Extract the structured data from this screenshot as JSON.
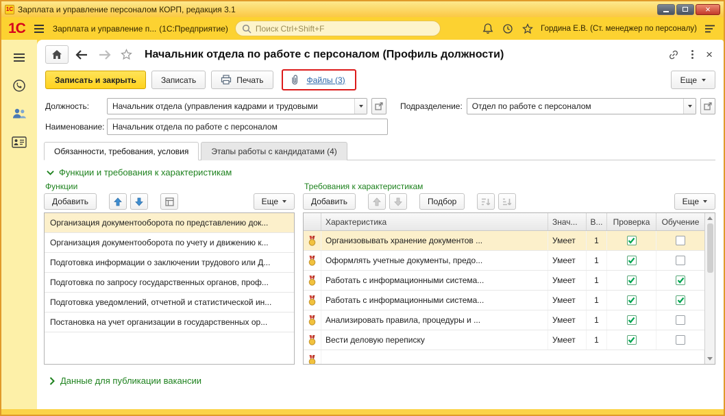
{
  "colors": {
    "accent_yellow": "#fcd231",
    "green": "#1e821e",
    "link_blue": "#2b66a8",
    "check_green": "#00a651",
    "annotation_red": "#dc1a1a"
  },
  "window": {
    "title": "Зарплата и управление персоналом КОРП, редакция 3.1"
  },
  "appbar": {
    "logo": "1С",
    "app_name": "Зарплата и управление п...",
    "app_kind": "(1С:Предприятие)",
    "search_placeholder": "Поиск Ctrl+Shift+F",
    "user": "Гордина Е.В. (Ст. менеджер по персоналу)"
  },
  "page": {
    "title": "Начальник отдела по работе с персоналом (Профиль должности)"
  },
  "toolbar": {
    "save_close": "Записать и закрыть",
    "save": "Записать",
    "print": "Печать",
    "files_link": "Файлы (3)",
    "more": "Еще"
  },
  "fields": {
    "position_label": "Должность:",
    "position_value": "Начальник отдела (управления кадрами и трудовыми",
    "department_label": "Подразделение:",
    "department_value": "Отдел по работе с персоналом",
    "name_label": "Наименование:",
    "name_value": "Начальник отдела по работе с персоналом"
  },
  "tabs": [
    {
      "label": "Обязанности, требования, условия",
      "active": true
    },
    {
      "label": "Этапы работы с кандидатами (4)",
      "active": false
    }
  ],
  "groups": {
    "functions_requirements": "Функции и требования к характеристикам",
    "vacancy": "Данные для публикации вакансии"
  },
  "functions": {
    "title": "Функции",
    "add": "Добавить",
    "more": "Еще",
    "items": [
      {
        "label": "Организация документооборота по представлению док...",
        "selected": true
      },
      {
        "label": "Организация документооборота по учету и движению к...",
        "selected": false
      },
      {
        "label": "Подготовка информации о заключении трудового или Д...",
        "selected": false
      },
      {
        "label": "Подготовка по запросу государственных органов, проф...",
        "selected": false
      },
      {
        "label": "Подготовка уведомлений, отчетной и статистической ин...",
        "selected": false
      },
      {
        "label": "Постановка на учет организации в государственных ор...",
        "selected": false
      }
    ]
  },
  "requirements": {
    "title": "Требования к характеристикам",
    "add": "Добавить",
    "pick": "Подбор",
    "more": "Еще",
    "columns": [
      "Характеристика",
      "Знач...",
      "В...",
      "Проверка",
      "Обучение"
    ],
    "rows": [
      {
        "name": "Организовывать хранение документов ...",
        "value": "Умеет",
        "count": "1",
        "check": true,
        "training": false,
        "selected": true
      },
      {
        "name": "Оформлять учетные документы, предо...",
        "value": "Умеет",
        "count": "1",
        "check": true,
        "training": false,
        "selected": false
      },
      {
        "name": "Работать с информационными система...",
        "value": "Умеет",
        "count": "1",
        "check": true,
        "training": true,
        "selected": false
      },
      {
        "name": "Работать с информационными система...",
        "value": "Умеет",
        "count": "1",
        "check": true,
        "training": true,
        "selected": false
      },
      {
        "name": "Анализировать правила, процедуры и ...",
        "value": "Умеет",
        "count": "1",
        "check": true,
        "training": false,
        "selected": false
      },
      {
        "name": "Вести деловую переписку",
        "value": "Умеет",
        "count": "1",
        "check": true,
        "training": false,
        "selected": false
      }
    ],
    "partial_row_visible": true
  }
}
